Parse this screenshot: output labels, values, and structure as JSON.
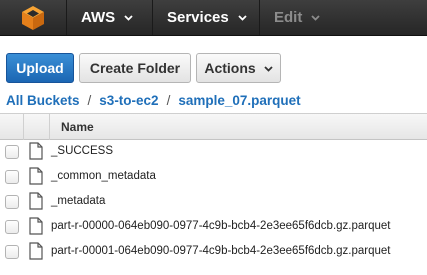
{
  "topbar": {
    "logo_icon": "aws-cube-logo-icon",
    "logo_color": "#f0931e",
    "aws_label": "AWS",
    "services_label": "Services",
    "edit_label": "Edit"
  },
  "toolbar": {
    "upload_label": "Upload",
    "create_folder_label": "Create Folder",
    "actions_label": "Actions",
    "primary_color": "#1b66b3"
  },
  "breadcrumb": {
    "items": [
      "All Buckets",
      "s3-to-ec2",
      "sample_07.parquet"
    ],
    "separator": "/",
    "link_color": "#1f6fb9"
  },
  "table": {
    "columns": [
      "Name"
    ],
    "rows": [
      {
        "name": "_SUCCESS",
        "icon": "file-icon",
        "checked": false
      },
      {
        "name": "_common_metadata",
        "icon": "file-icon",
        "checked": false
      },
      {
        "name": "_metadata",
        "icon": "file-icon",
        "checked": false
      },
      {
        "name": "part-r-00000-064eb090-0977-4c9b-bcb4-2e3ee65f6dcb.gz.parquet",
        "icon": "file-icon",
        "checked": false
      },
      {
        "name": "part-r-00001-064eb090-0977-4c9b-bcb4-2e3ee65f6dcb.gz.parquet",
        "icon": "file-icon",
        "checked": false
      }
    ]
  }
}
